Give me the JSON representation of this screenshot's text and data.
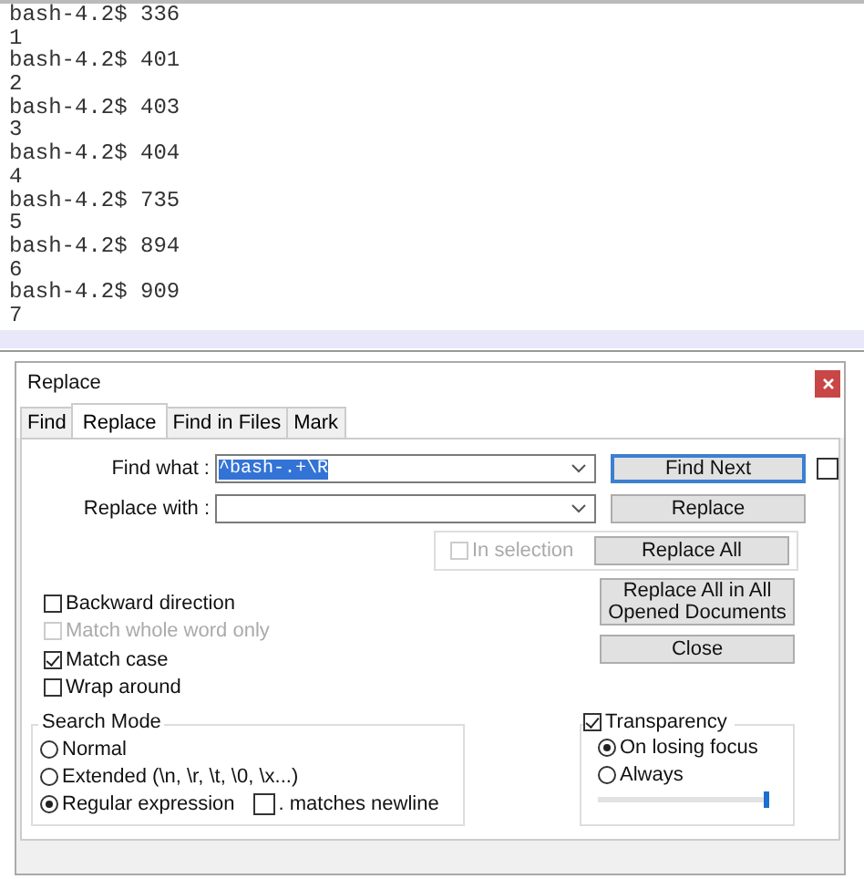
{
  "editor": {
    "lines": [
      "bash-4.2$ 336",
      "1",
      "bash-4.2$ 401",
      "2",
      "bash-4.2$ 403",
      "3",
      "bash-4.2$ 404",
      "4",
      "bash-4.2$ 735",
      "5",
      "bash-4.2$ 894",
      "6",
      "bash-4.2$ 909",
      "7"
    ],
    "current_line_highlighted": true
  },
  "dialog": {
    "title": "Replace",
    "tabs": [
      {
        "label": "Find",
        "selected": false
      },
      {
        "label": "Replace",
        "selected": true
      },
      {
        "label": "Find in Files",
        "selected": false
      },
      {
        "label": "Mark",
        "selected": false
      }
    ],
    "find_what": {
      "label": "Find what :",
      "value": "^bash-.+\\R",
      "value_selected": true
    },
    "replace_with": {
      "label": "Replace with :"
    },
    "in_selection": {
      "label": "In selection",
      "checked": false,
      "disabled": true
    },
    "buttons": [
      {
        "label": "Find Next",
        "default": true
      },
      {
        "label": "Replace",
        "default": false
      },
      {
        "label": "Replace All",
        "default": false
      },
      {
        "label": "Replace All in All Opened Documents",
        "default": false
      },
      {
        "label": "Close",
        "default": false
      }
    ],
    "side_checkbox": {
      "checked": false
    },
    "options": [
      {
        "label": "Backward direction",
        "checked": false,
        "disabled": false
      },
      {
        "label": "Match whole word only",
        "checked": false,
        "disabled": true
      },
      {
        "label": "Match case",
        "checked": true,
        "disabled": false
      },
      {
        "label": "Wrap around",
        "checked": false,
        "disabled": false
      }
    ],
    "search_mode": {
      "title": "Search Mode",
      "options": [
        {
          "label": "Normal",
          "selected": false
        },
        {
          "label": "Extended (\\n, \\r, \\t, \\0, \\x...)",
          "selected": false
        },
        {
          "label": "Regular expression",
          "selected": true
        }
      ],
      "matches_newline": {
        "label": ". matches newline",
        "checked": false
      }
    },
    "transparency": {
      "label": "Transparency",
      "checked": true,
      "options": [
        {
          "label": "On losing focus",
          "selected": true
        },
        {
          "label": "Always",
          "selected": false
        }
      ],
      "level": 1
    }
  }
}
